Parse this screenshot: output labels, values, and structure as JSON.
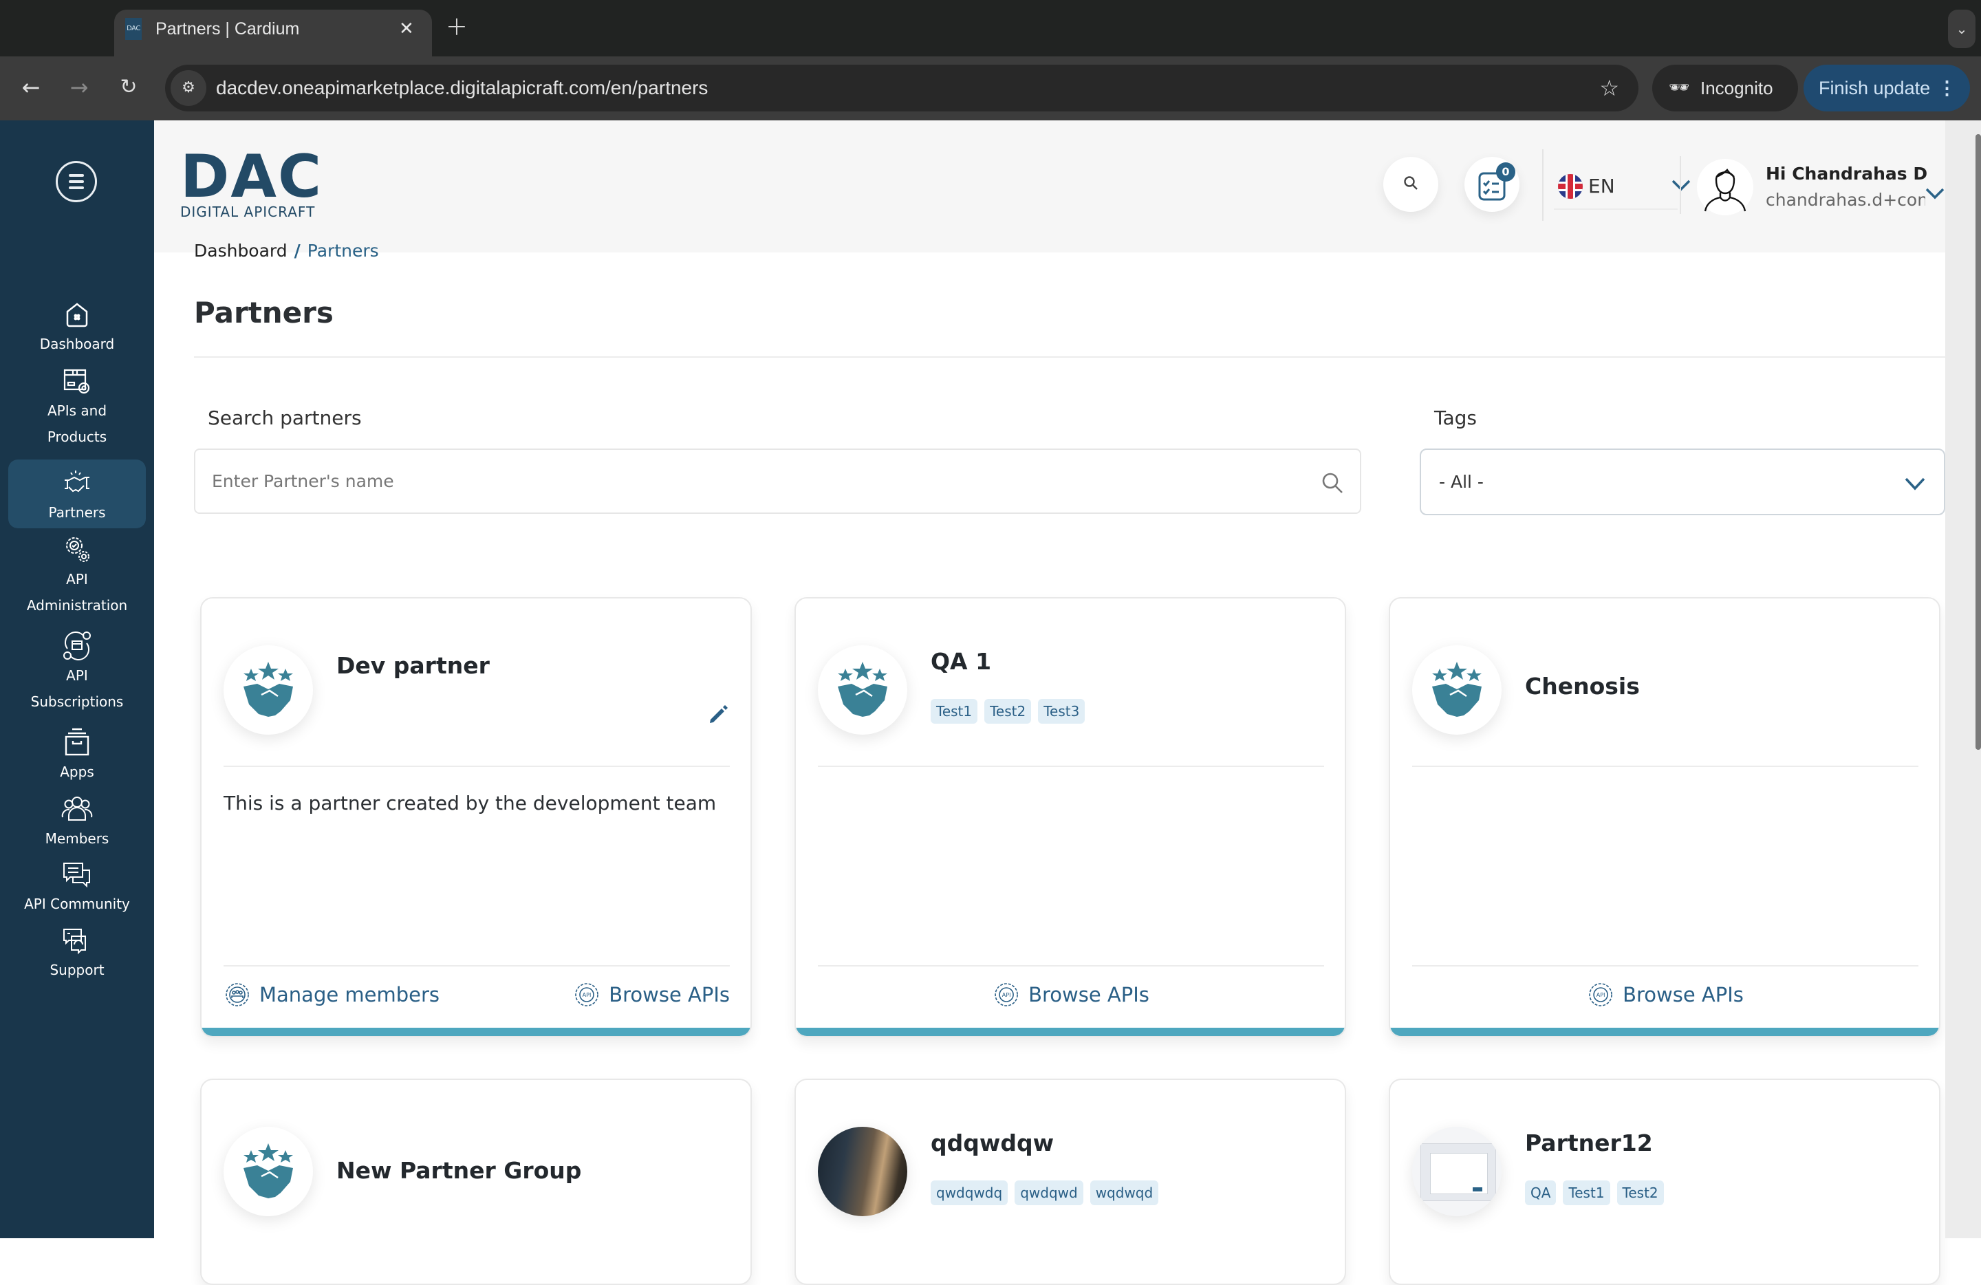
{
  "browser": {
    "tab_title": "Partners | Cardium",
    "tab_favicon_text": "DAC",
    "close_glyph": "✕",
    "new_tab_glyph": "+",
    "tab_search_glyph": "⌄",
    "back_glyph": "←",
    "forward_glyph": "→",
    "reload_glyph": "↻",
    "site_settings_glyph": "⚙",
    "url": "dacdev.oneapimarketplace.digitalapicraft.com/en/partners",
    "bookmark_glyph": "☆",
    "incognito_label": "Incognito",
    "incognito_glyph": "🕶",
    "finish_update_label": "Finish update",
    "menu_glyph": "⋮"
  },
  "logo": {
    "mark": "DAC",
    "subtitle": "DIGITAL APICRAFT",
    "color": "#234a66"
  },
  "sidebar": {
    "background": "#19364b",
    "active_background": "#244d68",
    "items": [
      {
        "label": "Dashboard",
        "icon": "home-icon",
        "active": false
      },
      {
        "label": "APIs and\nProducts",
        "icon": "package-gear-icon",
        "active": false
      },
      {
        "label": "Partners",
        "icon": "handshake-icon",
        "active": true
      },
      {
        "label": "API\nAdministration",
        "icon": "gears-icon",
        "active": false
      },
      {
        "label": "API\nSubscriptions",
        "icon": "subscription-cycle-icon",
        "active": false
      },
      {
        "label": "Apps",
        "icon": "archive-box-icon",
        "active": false
      },
      {
        "label": "Members",
        "icon": "users-icon",
        "active": false
      },
      {
        "label": "API Community",
        "icon": "chat-bubbles-icon",
        "active": false
      },
      {
        "label": "Support",
        "icon": "headset-chat-icon",
        "active": false
      }
    ]
  },
  "header": {
    "tasks_badge_count": "0",
    "language_code": "EN",
    "greeting": "Hi Chandrahas D",
    "email": "chandrahas.d+con..."
  },
  "breadcrumb": {
    "items": [
      "Dashboard",
      "Partners"
    ],
    "separator": "/"
  },
  "page": {
    "title": "Partners"
  },
  "filters": {
    "search_label": "Search partners",
    "search_placeholder": "Enter Partner's name",
    "search_value": "",
    "tags_label": "Tags",
    "tags_selected": "- All -"
  },
  "accent": {
    "primary": "#2a5f86",
    "card_bar": "#4ea7bf",
    "icon_teal": "#3a8196",
    "tag_bg": "#e1eef6"
  },
  "cards": [
    {
      "name": "Dev partner",
      "avatar": "handshake-stars",
      "tags": [],
      "editable": true,
      "description": "This is a partner created by the development team",
      "actions": [
        "Manage members",
        "Browse APIs"
      ]
    },
    {
      "name": "QA 1",
      "avatar": "handshake-stars",
      "tags": [
        "Test1",
        "Test2",
        "Test3"
      ],
      "editable": false,
      "description": "",
      "actions": [
        "Browse APIs"
      ]
    },
    {
      "name": "Chenosis",
      "avatar": "handshake-stars",
      "tags": [],
      "editable": false,
      "description": "",
      "actions": [
        "Browse APIs"
      ]
    },
    {
      "name": "New Partner Group",
      "avatar": "handshake-stars",
      "tags": [],
      "editable": false,
      "description": "",
      "actions": []
    },
    {
      "name": "qdqwdqw",
      "avatar": "photo",
      "tags": [
        "qwdqwdq",
        "qwdqwd",
        "wqdwqd"
      ],
      "editable": false,
      "description": "",
      "actions": []
    },
    {
      "name": "Partner12",
      "avatar": "screenshot",
      "tags": [
        "QA",
        "Test1",
        "Test2"
      ],
      "editable": false,
      "description": "",
      "actions": []
    }
  ]
}
